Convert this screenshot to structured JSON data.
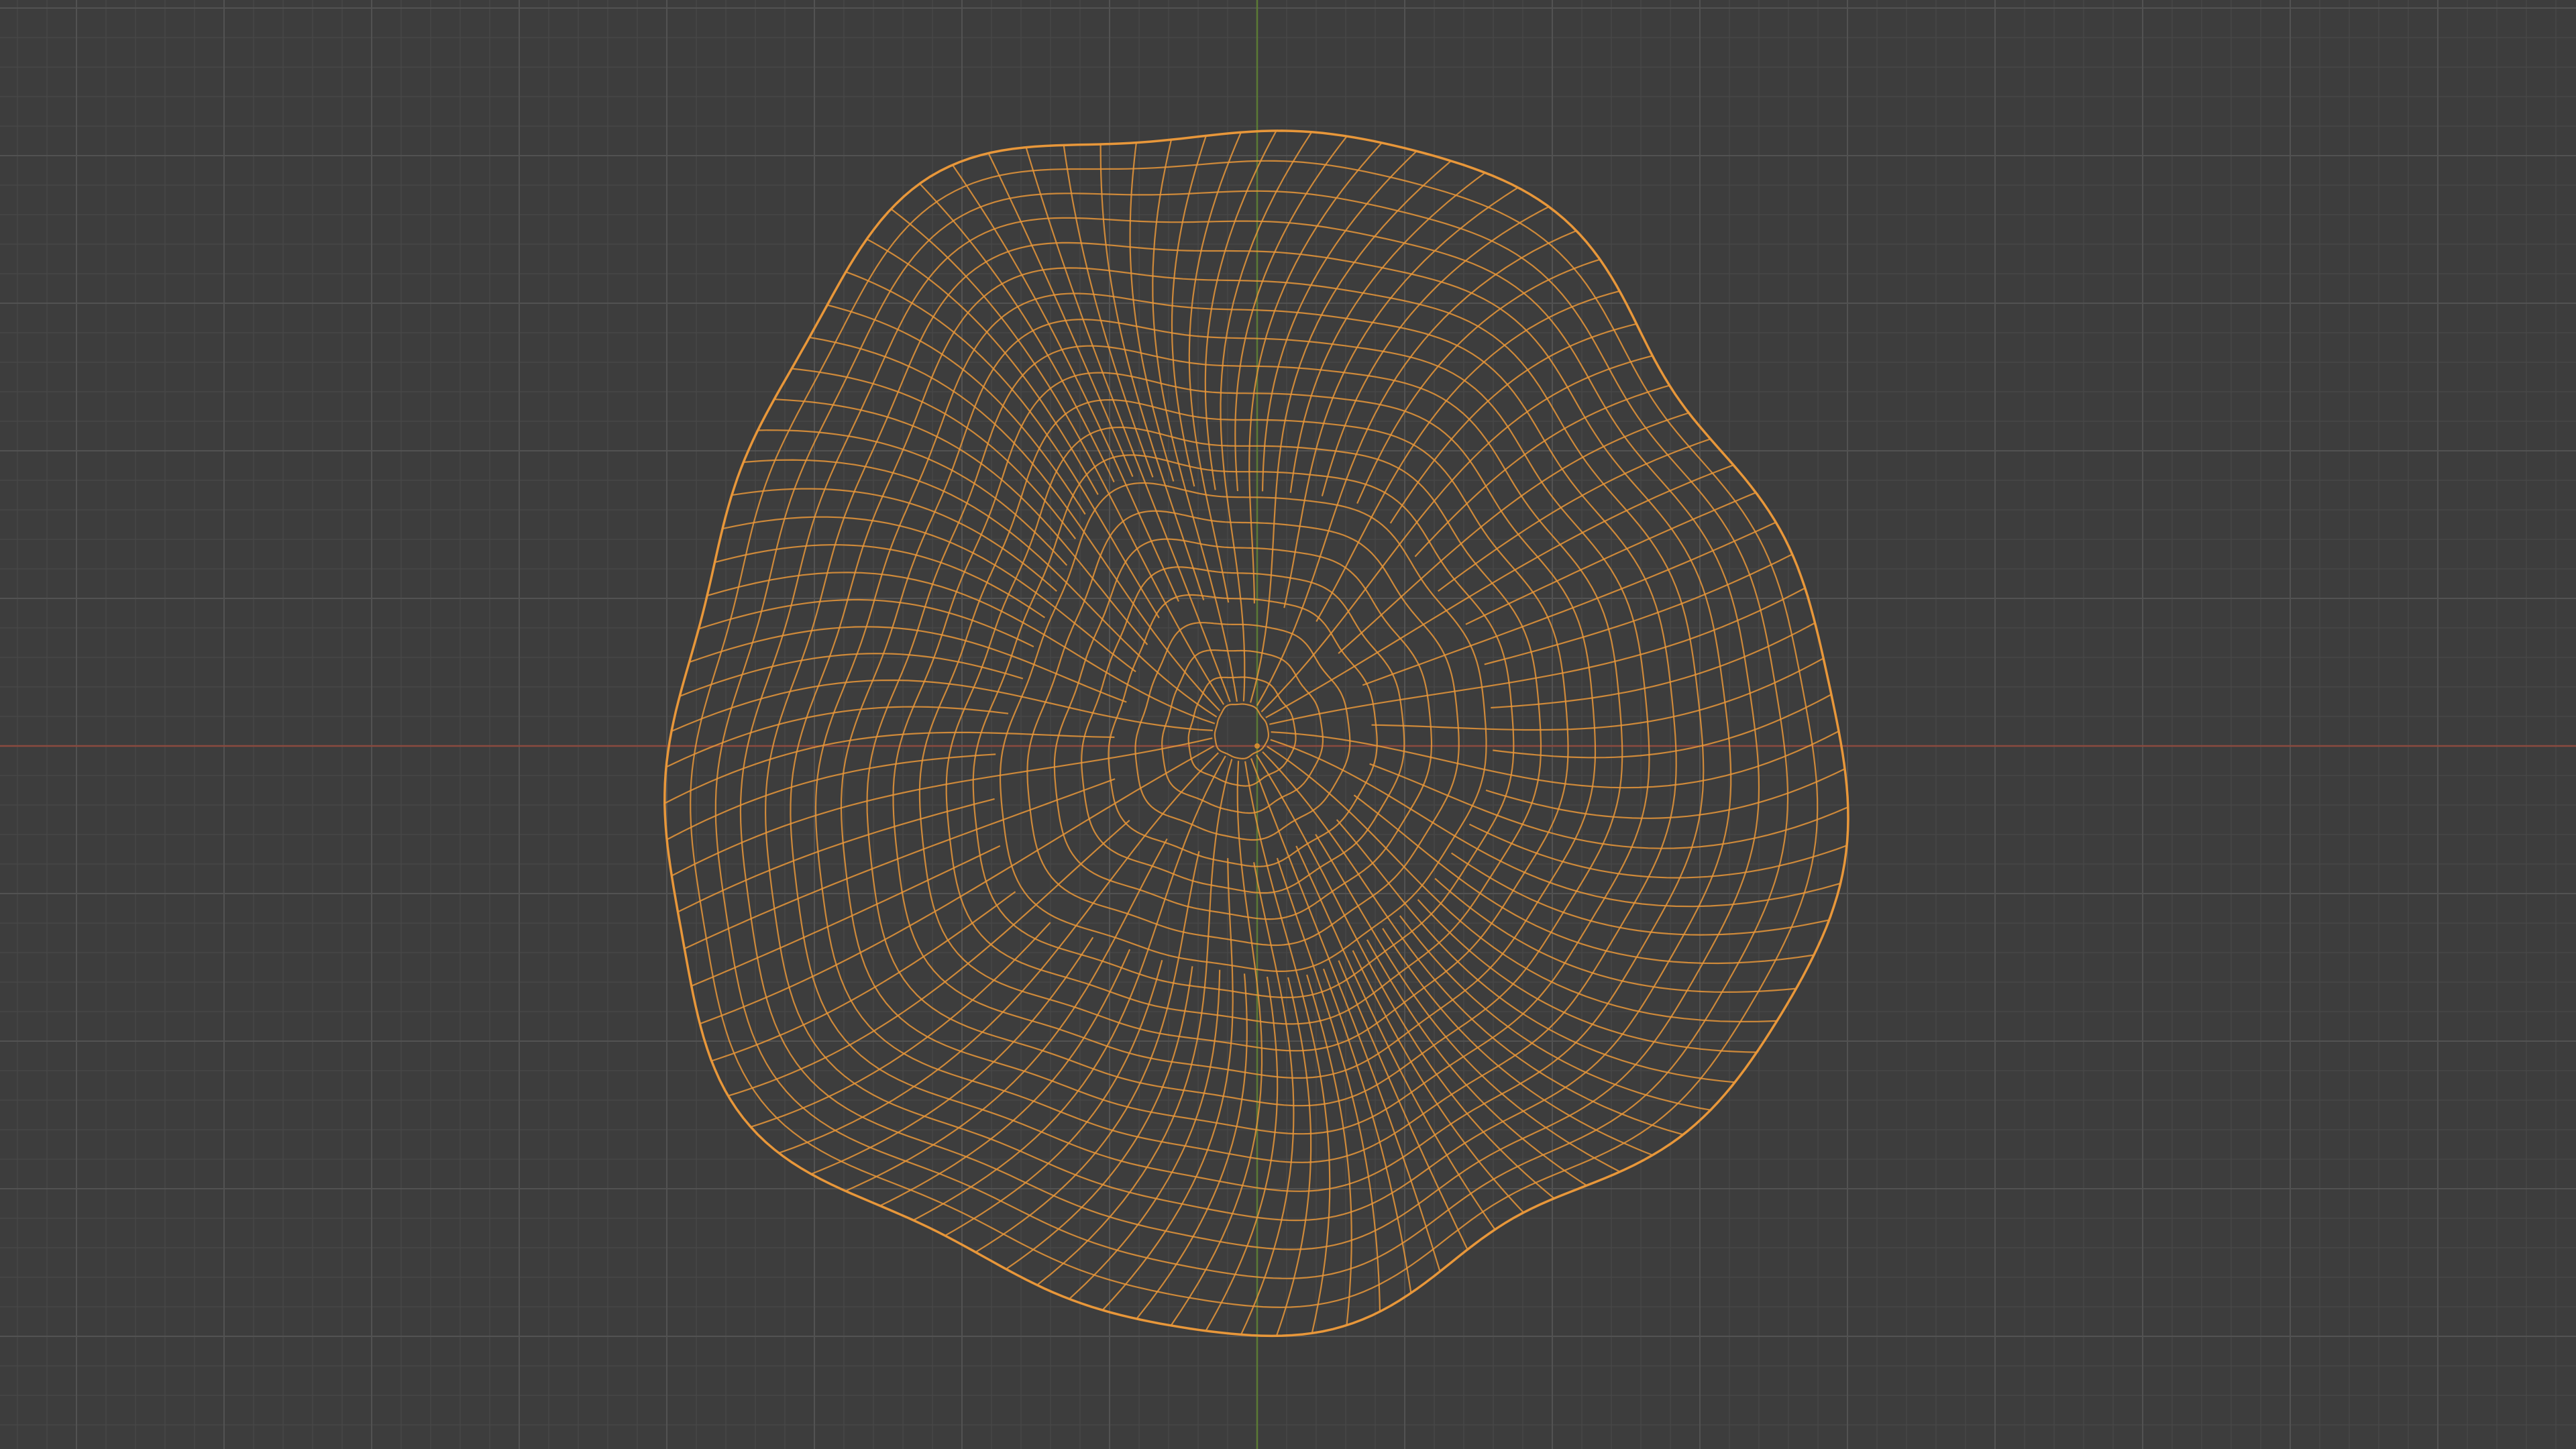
{
  "viewport": {
    "view": "top-orthographic",
    "shading": "wireframe",
    "background_color": "#3d3d3d",
    "grid": {
      "visible": true,
      "minor_color": "#474747",
      "major_color": "#525252"
    },
    "axes": {
      "x_axis_color": "#8a4a3f",
      "y_axis_color": "#5b7a35"
    },
    "selected_object": {
      "type": "mesh",
      "shape": "irregular-blob",
      "selected": true,
      "wire_color": "#e8973a",
      "origin_color": "#d08a30"
    }
  }
}
